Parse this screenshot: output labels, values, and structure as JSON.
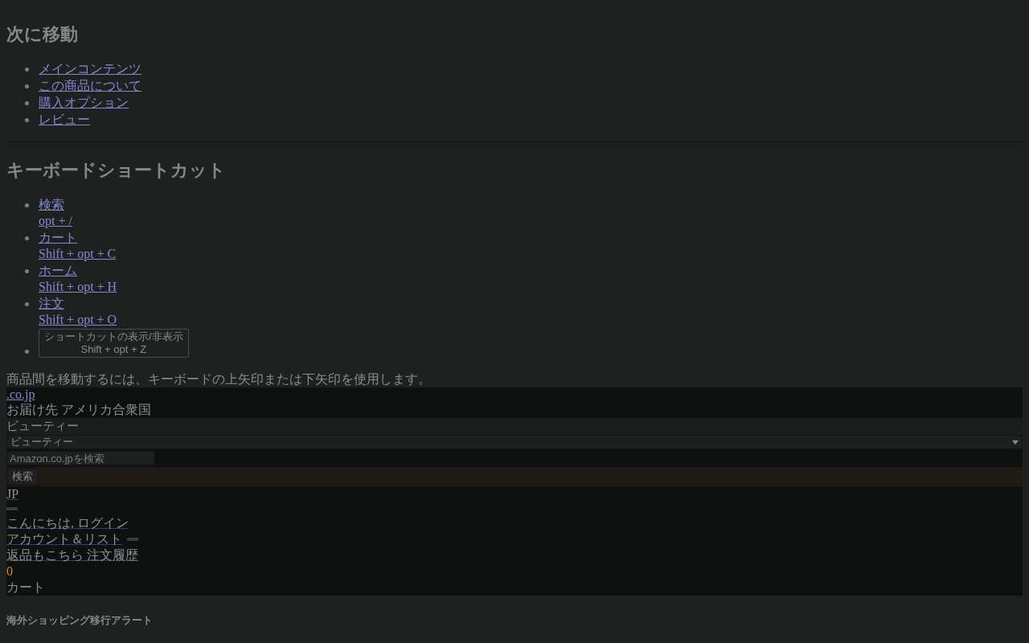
{
  "skip_nav": {
    "heading": "次に移動",
    "links": [
      "メインコンテンツ",
      "この商品について",
      "購入オプション",
      "レビュー"
    ]
  },
  "shortcuts": {
    "heading": "キーボードショートカット",
    "items": [
      {
        "label": "検索",
        "keys": "opt + /"
      },
      {
        "label": "カート",
        "keys": "Shift + opt + C"
      },
      {
        "label": "ホーム",
        "keys": "Shift + opt + H"
      },
      {
        "label": "注文",
        "keys": "Shift + opt + O"
      }
    ],
    "toggle": {
      "label": "ショートカットの表示/非表示",
      "keys": "Shift + opt + Z"
    }
  },
  "hint": "商品間を移動するには、キーボードの上矢印または下矢印を使用します。",
  "nav": {
    "logo_link": ".co.jp",
    "delivery": "お届け先 アメリカ合衆国",
    "category_label": "ビューティー",
    "category_select": "ビューティー",
    "search_placeholder": "Amazon.co.jpを検索",
    "search_button": "検索",
    "language": "JP",
    "greeting": "こんにちは, ログイン",
    "account": "アカウント＆リスト",
    "orders": "返品もこちら 注文履歴",
    "cart_count": "0",
    "cart_label": "カート"
  },
  "alert_heading": "海外ショッピング移行アラート"
}
